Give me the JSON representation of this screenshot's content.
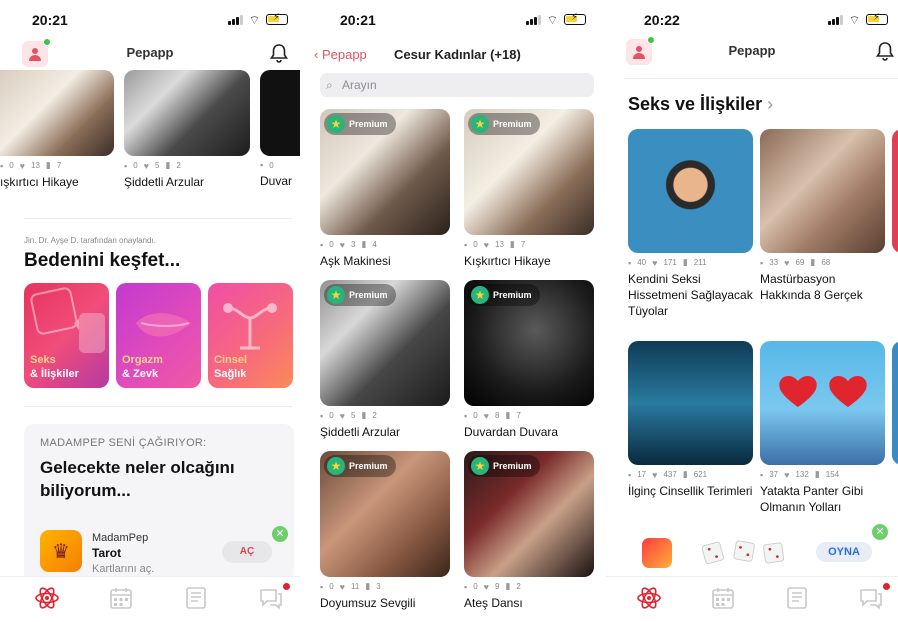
{
  "screen1": {
    "time": "20:21",
    "title": "Pepapp",
    "top_cards": [
      {
        "title": "ışkırtıcı Hikaye",
        "comments": "0",
        "likes": "13",
        "saves": "7"
      },
      {
        "title": "Şiddetli Arzular",
        "comments": "0",
        "likes": "5",
        "saves": "2"
      },
      {
        "title": "Duvar",
        "comments": "0",
        "likes": "",
        "saves": ""
      }
    ],
    "approved_by": "Jin. Dr. Ayşe D. tarafından onaylandı.",
    "section_title": "Bedenini keşfet...",
    "categories": [
      {
        "line1": "Seks",
        "line2": "& İlişkiler"
      },
      {
        "line1": "Orgazm",
        "line2": "& Zevk"
      },
      {
        "line1": "Cinsel",
        "line2": "Sağlık"
      }
    ],
    "promo": {
      "kicker": "MADAMPEP SENİ ÇAĞIRIYOR:",
      "headline": "Gelecekte neler olcağını biliyorum...",
      "app_name": "MadamPep",
      "app_title": "Tarot",
      "app_sub": "Kartlarını aç.",
      "button": "AÇ"
    }
  },
  "screen2": {
    "time": "20:21",
    "back_label": "Pepapp",
    "title": "Cesur Kadınlar (+18)",
    "search_placeholder": "Arayın",
    "premium_label": "Premium",
    "cards": [
      {
        "title": "Aşk Makinesi",
        "comments": "0",
        "likes": "3",
        "saves": "4"
      },
      {
        "title": "Kışkırtıcı Hikaye",
        "comments": "0",
        "likes": "13",
        "saves": "7"
      },
      {
        "title": "Şiddetli Arzular",
        "comments": "0",
        "likes": "5",
        "saves": "2"
      },
      {
        "title": "Duvardan Duvara",
        "comments": "0",
        "likes": "8",
        "saves": "7"
      },
      {
        "title": "Doyumsuz Sevgili",
        "comments": "0",
        "likes": "11",
        "saves": "3"
      },
      {
        "title": "Ateş Dansı",
        "comments": "0",
        "likes": "9",
        "saves": "2"
      }
    ]
  },
  "screen3": {
    "time": "20:22",
    "title": "Pepapp",
    "section_title": "Seks ve İlişkiler",
    "cards": [
      {
        "title": "Kendini Seksi Hissetmeni Sağlayacak Tüyolar",
        "comments": "40",
        "likes": "171",
        "saves": "211"
      },
      {
        "title": "Mastürbasyon Hakkında 8 Gerçek",
        "comments": "33",
        "likes": "69",
        "saves": "68"
      },
      {
        "title": "İlginç Cinsellik Terimleri",
        "comments": "17",
        "likes": "437",
        "saves": "621"
      },
      {
        "title": "Yatakta Panter Gibi Olmanın Yolları",
        "comments": "37",
        "likes": "132",
        "saves": "154"
      }
    ],
    "ad_button": "OYNA"
  },
  "colors": {
    "accent": "#e25461",
    "green": "#26b57a",
    "tab_active": "#e5202e"
  }
}
